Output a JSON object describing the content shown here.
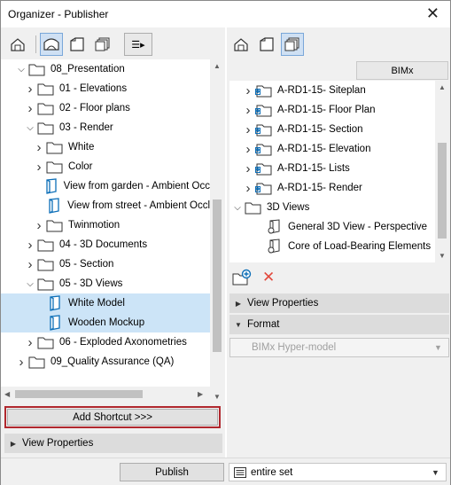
{
  "window": {
    "title": "Organizer - Publisher",
    "close_glyph": "✕"
  },
  "left_toolbar": {
    "icons": [
      "project-map-icon",
      "view-map-icon",
      "layout-book-icon",
      "publisher-sets-icon"
    ],
    "menu_glyph": "☰▸"
  },
  "left_tree": {
    "rows": [
      {
        "label": "08_Presentation",
        "depth": 0,
        "expand": "open",
        "icon": "folder",
        "selected": false
      },
      {
        "label": "01 - Elevations",
        "depth": 1,
        "expand": "closed",
        "icon": "folder",
        "selected": false
      },
      {
        "label": "02 - Floor plans",
        "depth": 1,
        "expand": "closed",
        "icon": "folder",
        "selected": false
      },
      {
        "label": "03 - Render",
        "depth": 1,
        "expand": "open",
        "icon": "folder",
        "selected": false
      },
      {
        "label": "White",
        "depth": 2,
        "expand": "closed",
        "icon": "folder",
        "selected": false
      },
      {
        "label": "Color",
        "depth": 2,
        "expand": "closed",
        "icon": "folder",
        "selected": false
      },
      {
        "label": "View from garden - Ambient Occ",
        "depth": 2,
        "expand": "none",
        "icon": "view3d",
        "selected": false
      },
      {
        "label": "View from street - Ambient Occl",
        "depth": 2,
        "expand": "none",
        "icon": "view3d",
        "selected": false
      },
      {
        "label": "Twinmotion",
        "depth": 2,
        "expand": "closed",
        "icon": "folder",
        "selected": false
      },
      {
        "label": "04 - 3D Documents",
        "depth": 1,
        "expand": "closed",
        "icon": "folder",
        "selected": false
      },
      {
        "label": "05 - Section",
        "depth": 1,
        "expand": "closed",
        "icon": "folder",
        "selected": false
      },
      {
        "label": "05 - 3D Views",
        "depth": 1,
        "expand": "open",
        "icon": "folder",
        "selected": false
      },
      {
        "label": "White Model",
        "depth": 2,
        "expand": "none",
        "icon": "view3d",
        "selected": true
      },
      {
        "label": "Wooden Mockup",
        "depth": 2,
        "expand": "none",
        "icon": "view3d",
        "selected": true
      },
      {
        "label": "06 - Exploded Axonometries",
        "depth": 1,
        "expand": "closed",
        "icon": "folder",
        "selected": false
      },
      {
        "label": "09_Quality Assurance (QA)",
        "depth": 0,
        "expand": "closed",
        "icon": "folder",
        "selected": false
      }
    ]
  },
  "add_shortcut_label": "Add Shortcut >>>",
  "left_view_properties": "View Properties",
  "right_toolbar": {
    "icons": [
      "project-map-icon",
      "view-map-icon",
      "layout-book-icon"
    ]
  },
  "right_tab": "BIMx",
  "right_tree": {
    "rows": [
      {
        "label": "A-RD1-15- Siteplan",
        "depth": 1,
        "expand": "closed",
        "icon": "hyperfolder"
      },
      {
        "label": "A-RD1-15- Floor Plan",
        "depth": 1,
        "expand": "closed",
        "icon": "hyperfolder"
      },
      {
        "label": "A-RD1-15- Section",
        "depth": 1,
        "expand": "closed",
        "icon": "hyperfolder"
      },
      {
        "label": "A-RD1-15- Elevation",
        "depth": 1,
        "expand": "closed",
        "icon": "hyperfolder"
      },
      {
        "label": "A-RD1-15- Lists",
        "depth": 1,
        "expand": "closed",
        "icon": "hyperfolder"
      },
      {
        "label": "A-RD1-15- Render",
        "depth": 1,
        "expand": "closed",
        "icon": "hyperfolder"
      },
      {
        "label": "3D Views",
        "depth": 0,
        "expand": "open",
        "icon": "folder"
      },
      {
        "label": "General 3D View - Perspective",
        "depth": 2,
        "expand": "none",
        "icon": "view3dlink"
      },
      {
        "label": "Core of Load-Bearing Elements",
        "depth": 2,
        "expand": "none",
        "icon": "view3dlink"
      }
    ]
  },
  "right_actions": {
    "new_folder_icon": "new-folder-icon",
    "delete_glyph": "✕"
  },
  "right_view_properties": "View Properties",
  "format_label": "Format",
  "format_value": "BIMx Hyper-model",
  "publish_label": "Publish",
  "set_select": {
    "value": "entire set"
  },
  "colors": {
    "accent": "#0d6fb8",
    "selected_row": "#cce4f7",
    "highlight_border": "#b0282e",
    "delete_red": "#e2493d"
  }
}
